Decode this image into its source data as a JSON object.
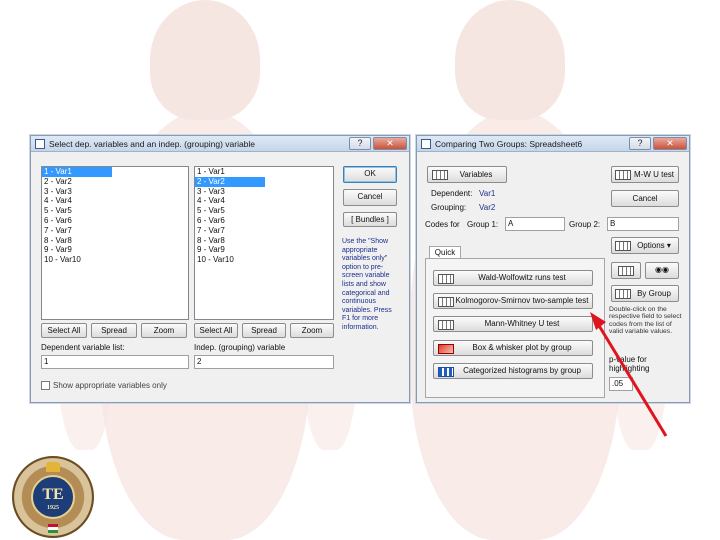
{
  "left_dialog": {
    "title": "Select dep. variables and an indep. (grouping) variable",
    "help_label": "?",
    "close_label": "✕",
    "list1": [
      "1 - Var1",
      "2 - Var2",
      "3 - Var3",
      "4 - Var4",
      "5 - Var5",
      "6 - Var6",
      "7 - Var7",
      "8 - Var8",
      "9 - Var9",
      "10 - Var10"
    ],
    "list2": [
      "1 - Var1",
      "2 - Var2",
      "3 - Var3",
      "4 - Var4",
      "5 - Var5",
      "6 - Var6",
      "7 - Var7",
      "8 - Var8",
      "9 - Var9",
      "10 - Var10"
    ],
    "list1_selected_index": 0,
    "list2_selected_index": 1,
    "select_all_label": "Select All",
    "spread_label": "Spread",
    "zoom_label": "Zoom",
    "dep_list_label": "Dependent variable list:",
    "dep_list_value": "1",
    "indep_label": "Indep. (grouping) variable",
    "indep_value": "2",
    "show_appropriate_label": "Show appropriate variables only",
    "ok_label": "OK",
    "cancel_label": "Cancel",
    "bundles_label": "[ Bundles ]",
    "hint_text": "Use the \"Show appropriate variables only\" option to pre-screen variable lists and show categorical and continuous variables. Press F1 for more information."
  },
  "right_dialog": {
    "title": "Comparing Two Groups: Spreadsheet6",
    "help_label": "?",
    "close_label": "✕",
    "variables_label": "Variables",
    "dependent_label": "Dependent:",
    "dependent_value": "Var1",
    "grouping_label": "Grouping:",
    "grouping_value": "Var2",
    "codes_for_label": "Codes for",
    "group1_label": "Group 1:",
    "group1_value": "A",
    "group2_label": "Group 2:",
    "group2_value": "B",
    "mw_label": "M-W U test",
    "cancel_label": "Cancel",
    "options_label": "Options",
    "by_group_label": "By Group",
    "tab_label": "Quick",
    "tests": [
      "Wald-Wolfowitz runs test",
      "Kolmogorov-Smirnov two-sample test",
      "Mann-Whitney U test",
      "Box & whisker plot by group",
      "Categorized histograms by group"
    ],
    "hint_text": "Double-click on the respective field to select codes from the list of valid variable values.",
    "p_value_label": "p-value for highlighting",
    "p_value": ".05"
  },
  "logo": {
    "initials": "TE",
    "year": "1925"
  },
  "colors": {
    "selection": "#3399ff",
    "arrow": "#e0141e",
    "hint_text": "#1c2f8c"
  }
}
